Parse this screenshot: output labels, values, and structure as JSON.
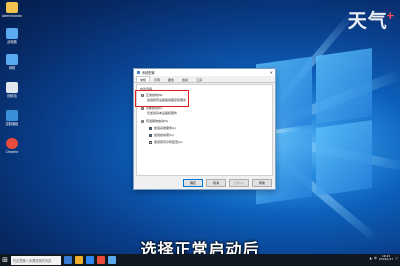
{
  "watermark": {
    "text": "天气",
    "sup": "+"
  },
  "desktop_icons": [
    {
      "label": "Administrator",
      "color": "#f2c14e"
    },
    {
      "label": "此电脑",
      "color": "#5aaaf0"
    },
    {
      "label": "网络",
      "color": "#5aaaf0"
    },
    {
      "label": "回收站",
      "color": "#dfe6ee"
    },
    {
      "label": "控制面板",
      "color": "#3b8fd8"
    },
    {
      "label": "Chrome",
      "color": "#e94b3c"
    }
  ],
  "dialog": {
    "title": "系统配置",
    "close": "✕",
    "tabs": [
      "常规",
      "引导",
      "服务",
      "启动",
      "工具"
    ],
    "group_label": "启动选择",
    "options": [
      {
        "label": "正常启动(N)",
        "type": "radio",
        "checked": true
      },
      {
        "label": "加载所有设备驱动程序和服务",
        "type": "text"
      },
      {
        "label": "诊断启动(D)",
        "type": "radio",
        "checked": false
      },
      {
        "label": "仅加载基本设备和服务",
        "type": "text"
      },
      {
        "label": "有选择的启动(S)",
        "type": "radio",
        "checked": false
      },
      {
        "label": "加载系统服务(L)",
        "type": "check",
        "checked": true
      },
      {
        "label": "加载启动项(O)",
        "type": "check",
        "checked": true
      },
      {
        "label": "使用原有引导配置(U)",
        "type": "check",
        "checked": false
      }
    ],
    "buttons": {
      "ok": "确定",
      "cancel": "取消",
      "apply": "应用(A)",
      "help": "帮助"
    }
  },
  "subtitle": "选择正常启动后",
  "taskbar": {
    "search_placeholder": "在这里输入你要搜索的内容",
    "apps": [
      "#3a7bd5",
      "#f0b030",
      "#2d89ef",
      "#e94b3c",
      "#5aaaf0"
    ],
    "tray_lang": "中",
    "time": "16:23",
    "date": "2019/1/17"
  }
}
